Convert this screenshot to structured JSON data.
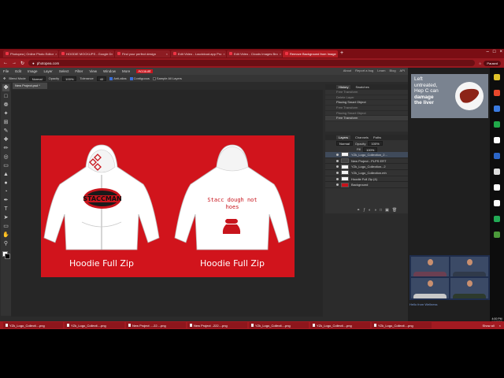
{
  "browser": {
    "tabs": [
      {
        "label": "Photopea | Online Photo Editor",
        "active": false
      },
      {
        "label": "HOODIE MOCKUPS - Google Dr",
        "active": false
      },
      {
        "label": "Find your perfect design",
        "active": false
      },
      {
        "label": "Edit Video - Loudcloud.app Pro",
        "active": false
      },
      {
        "label": "Edit Video - Clouds Images Bro",
        "active": false
      },
      {
        "label": "Remove Background from Image",
        "active": true
      }
    ],
    "url": "photopea.com",
    "profile_label": "Paused"
  },
  "menubar": {
    "items": [
      "File",
      "Edit",
      "Image",
      "Layer",
      "Select",
      "Filter",
      "View",
      "Window",
      "More",
      "Account"
    ],
    "highlight_index": 9,
    "right_links": [
      "About",
      "Report a bug",
      "Learn",
      "Blog",
      "API"
    ]
  },
  "options": {
    "tool_label": "Blend Mode",
    "mode_value": "Normal",
    "opacity_label": "Opacity",
    "opacity_value": "100%",
    "tolerance_label": "Tolerance",
    "tolerance_value": "40",
    "antialias_label": "Anti-alias",
    "contiguous_label": "Contiguous",
    "sample_label": "Sample All Layers"
  },
  "document": {
    "tab_label": "New Project.psd *"
  },
  "canvas": {
    "left_label": "Hoodie Full Zip",
    "right_label": "Hoodie Full Zip",
    "back_print_line1": "Stacc dough not",
    "back_print_line2": "hoes"
  },
  "history": {
    "tabs": [
      "History",
      "Swatches"
    ],
    "items": [
      {
        "label": "Free Transform",
        "state": "dim"
      },
      {
        "label": "Delete Layer",
        "state": "dim"
      },
      {
        "label": "Placing Smart Object",
        "state": "normal"
      },
      {
        "label": "Free Transform",
        "state": "dim"
      },
      {
        "label": "Placing Smart Object",
        "state": "dim"
      },
      {
        "label": "Free Transform",
        "state": "current"
      }
    ]
  },
  "layers": {
    "tabs": [
      "Layers",
      "Channels",
      "Paths"
    ],
    "blend_value": "Normal",
    "opacity_label": "Opacity",
    "opacity_value": "100%",
    "fill_label": "Fill",
    "fill_value": "100%",
    "items": [
      {
        "label": "YZk_Logo_Collection_2...",
        "thumb": "light",
        "selected": true
      },
      {
        "label": "New Project - PLPS ERT",
        "thumb": "dark",
        "selected": false
      },
      {
        "label": "YZk_Logo_Collection...2",
        "thumb": "light",
        "selected": false
      },
      {
        "label": "YZk_Logo_Collection.mh",
        "thumb": "light",
        "selected": false
      },
      {
        "label": "Hoodie Full Zip (4)",
        "thumb": "light",
        "selected": false
      },
      {
        "label": "Background",
        "thumb": "red",
        "selected": false
      }
    ]
  },
  "ad": {
    "line1": "Left",
    "line2": "untreated,",
    "line3": "Hep C can",
    "line4": "damage",
    "line5": "the liver"
  },
  "video": {
    "caption": "Hello from Wellness"
  },
  "downloads": {
    "items": [
      "YZk_Logo_Collecti....png",
      "YZk_Logo_Collecti....png",
      "New Project ....22....png",
      "New Project ..222....png",
      "YZk_Logo_Collecti....png",
      "YZk_Logo_Collecti....png",
      "YZk_Logo_Collecti....png"
    ],
    "show_all": "Show all"
  },
  "taskbar": {
    "time": "4:00 PM",
    "date": "1/9/2022"
  },
  "colors": {
    "brand_red": "#c8141c",
    "canvas_red": "#d1141c",
    "panel": "#323232"
  },
  "icons": [
    "close-icon",
    "plus-icon",
    "back-icon",
    "forward-icon",
    "reload-icon",
    "lock-icon",
    "star-icon",
    "file-icon",
    "eye-icon",
    "move-tool-icon",
    "brush-tool-icon"
  ]
}
